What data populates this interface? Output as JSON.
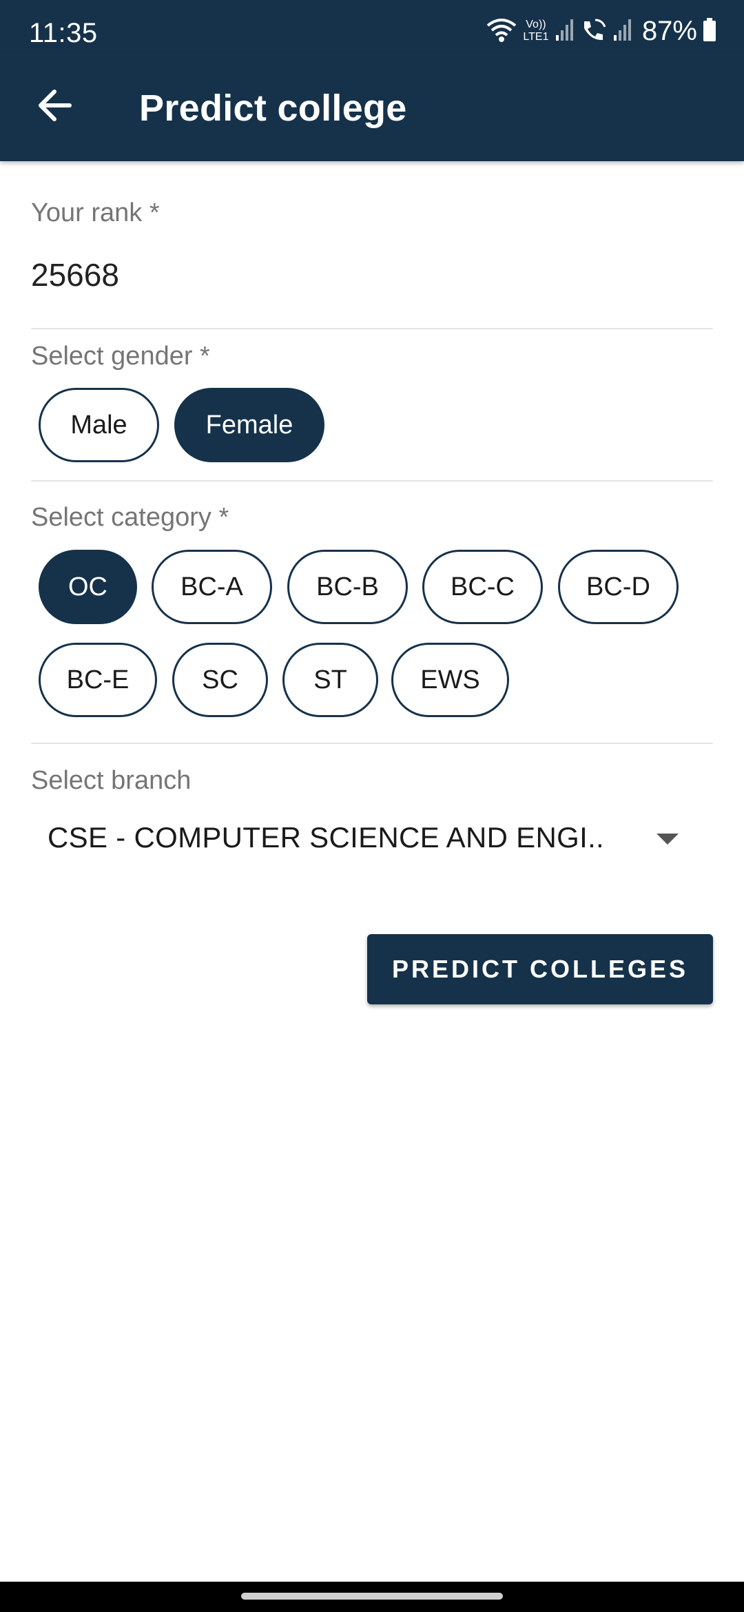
{
  "status_bar": {
    "time": "11:35",
    "lte_label": "Vo)) LTE1",
    "battery_text": "87%"
  },
  "app_bar": {
    "title": "Predict college",
    "back_icon": "arrow-back-icon"
  },
  "rank": {
    "label": "Your rank *",
    "value": "25668"
  },
  "gender": {
    "label": "Select gender *",
    "options": [
      "Male",
      "Female"
    ],
    "selected": "Female"
  },
  "category": {
    "label": "Select category *",
    "options": [
      "OC",
      "BC-A",
      "BC-B",
      "BC-C",
      "BC-D",
      "BC-E",
      "SC",
      "ST",
      "EWS"
    ],
    "selected": "OC"
  },
  "branch": {
    "label": "Select branch",
    "value": "CSE - COMPUTER SCIENCE AND ENGI..",
    "dropdown_icon": "triangle-down-icon"
  },
  "actions": {
    "predict_label": "PREDICT COLLEGES"
  },
  "colors": {
    "primary": "#16324a",
    "background": "#ffffff",
    "label_gray": "#757575"
  }
}
